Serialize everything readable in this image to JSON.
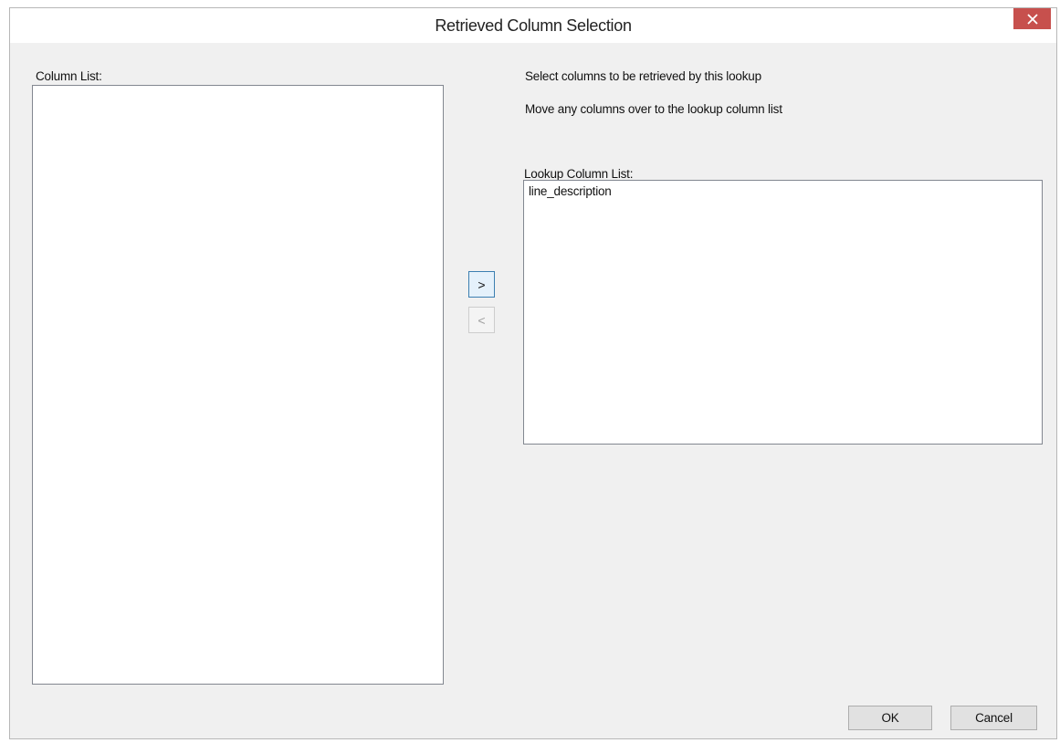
{
  "window": {
    "title": "Retrieved Column Selection",
    "close_glyph": "×"
  },
  "column_list": {
    "label": "Column List:",
    "items": []
  },
  "instructions": {
    "line1": "Select columns to be retrieved by this lookup",
    "line2": "Move any columns over to the lookup column list"
  },
  "lookup_column_list": {
    "label": "Lookup Column List:",
    "items": [
      "line_description"
    ]
  },
  "move_buttons": {
    "add_label": ">",
    "remove_label": "<"
  },
  "footer": {
    "ok_label": "OK",
    "cancel_label": "Cancel"
  },
  "colors": {
    "close_button": "#c7504d",
    "dialog_background": "#f0f0f0",
    "focus_border": "#3c7fb1"
  },
  "icons": {
    "close": "close-icon"
  }
}
